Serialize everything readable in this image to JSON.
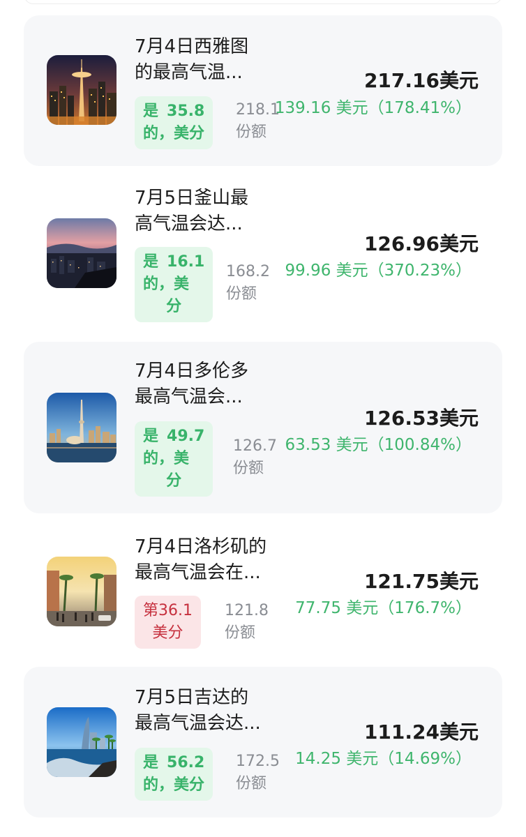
{
  "markets": [
    {
      "title": "7月4日西雅图的最高气温...",
      "title_line1": "7月4日西雅图",
      "title_line2": "的最高气温...",
      "outcome_parts": [
        "是",
        "35.8",
        "的，美分"
      ],
      "shares_amount": "218.1",
      "shares_unit": "份额",
      "value": "217.16美元",
      "gain": "139.16 美元（178.41%）",
      "image_icon": "seattle-space-needle-night-icon"
    },
    {
      "title": "7月5日釜山最高气温会达...",
      "title_line1": "7月5日釜山最",
      "title_line2": "高气温会达...",
      "outcome_parts": [
        "是",
        "16.1",
        "的，美",
        "分"
      ],
      "shares_amount": "168.2",
      "shares_unit": "份额",
      "value": "126.96美元",
      "gain": "99.96 美元（370.23%）",
      "image_icon": "busan-city-dusk-icon"
    },
    {
      "title": "7月4日多伦多最高气温会...",
      "title_line1": "7月4日多伦多",
      "title_line2": "最高气温会...",
      "outcome_parts": [
        "是",
        "49.7",
        "的，美",
        "分"
      ],
      "shares_amount": "126.7",
      "shares_unit": "份额",
      "value": "126.53美元",
      "gain": "63.53 美元（100.84%）",
      "image_icon": "toronto-skyline-icon"
    },
    {
      "title": "7月4日洛杉矶的最高气温会在...",
      "title_line1": "7月4日洛杉矶的",
      "title_line2": "最高气温会在...",
      "outcome_parts": [
        "第36.1",
        "美分"
      ],
      "shares_amount": "121.8",
      "shares_unit": "份额",
      "value": "121.75美元",
      "gain": "77.75 美元（176.7%）",
      "image_icon": "los-angeles-street-icon"
    },
    {
      "title": "7月5日吉达的最高气温会达...",
      "title_line1": "7月5日吉达的",
      "title_line2": "最高气温会达...",
      "outcome_parts": [
        "是",
        "56.2",
        "的，美分"
      ],
      "shares_amount": "172.5",
      "shares_unit": "份额",
      "value": "111.24美元",
      "gain": "14.25 美元（14.69%）",
      "image_icon": "jeddah-coast-icon"
    }
  ],
  "colors": {
    "card_bg": "#f6f7f9",
    "yes_bg": "#e4f7ea",
    "yes_text": "#38b36a",
    "no_bg": "#fbe5e7",
    "no_text": "#c6303e",
    "gain_text": "#3fb56d",
    "muted_text": "#8a8d93"
  }
}
